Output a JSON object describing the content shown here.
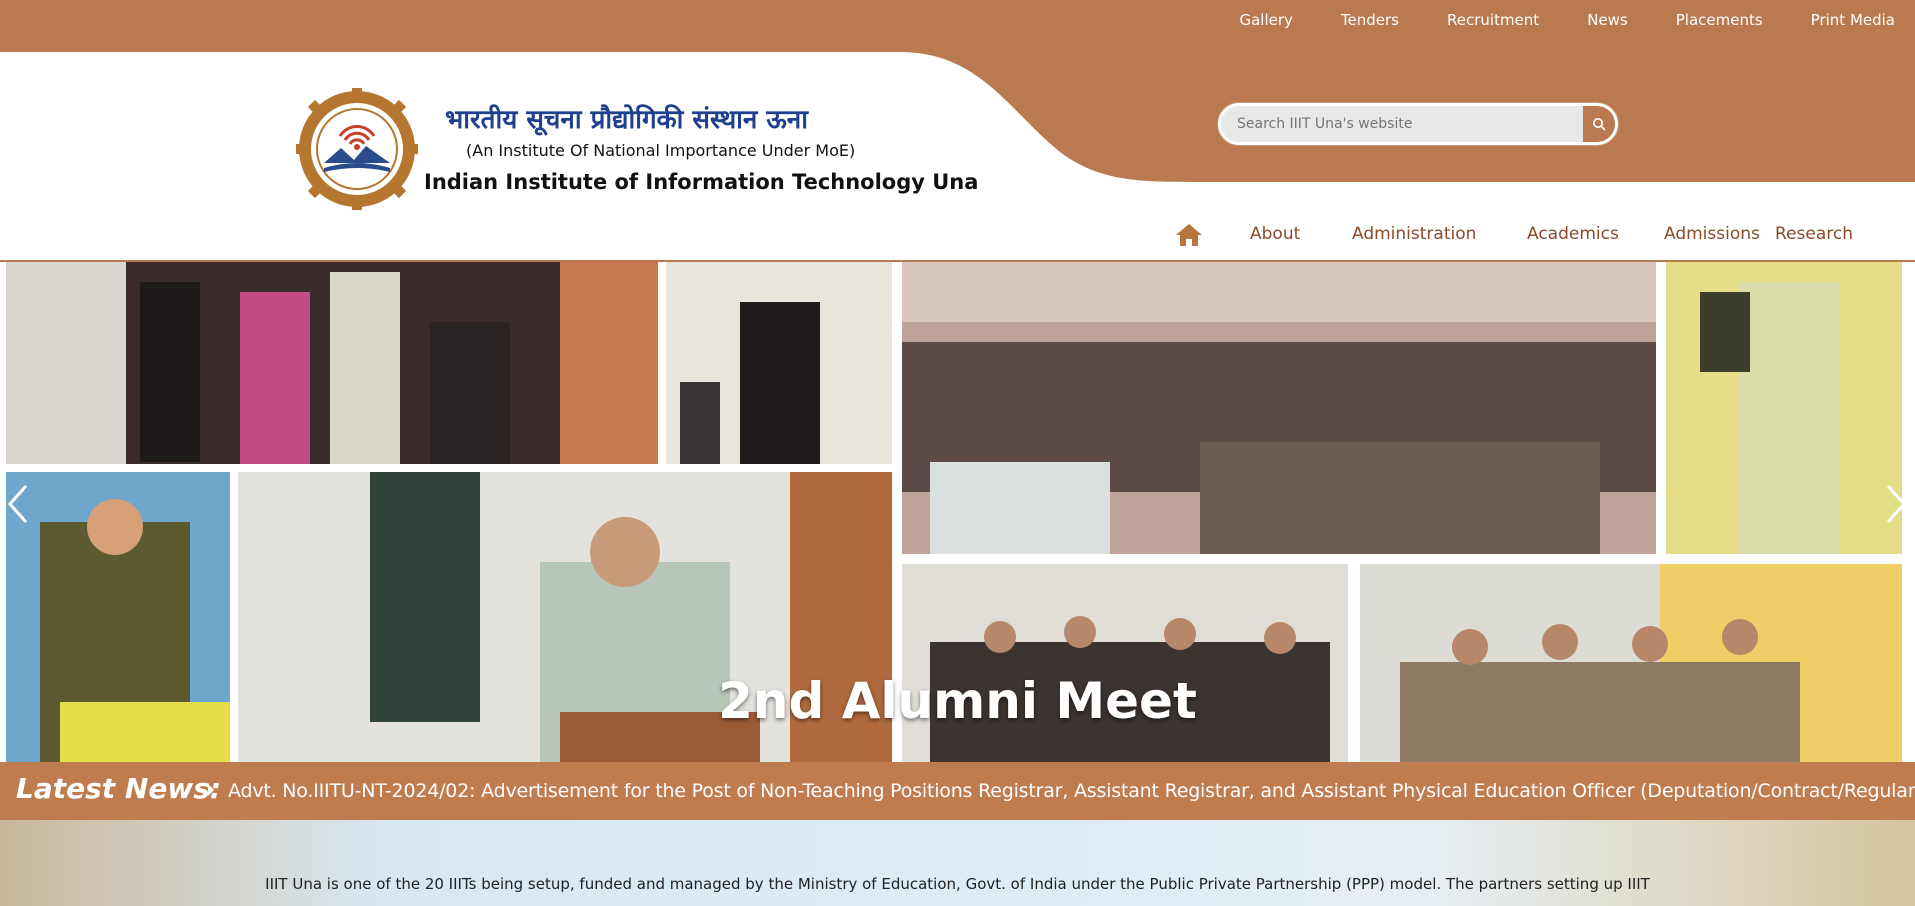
{
  "top_links": [
    "Gallery",
    "Tenders",
    "Recruitment",
    "News",
    "Placements",
    "Print Media"
  ],
  "header": {
    "hindi_name": "भारतीय सूचना प्रौद्योगिकी संस्थान ऊना",
    "subtitle": "(An Institute Of National Importance Under MoE)",
    "title": "Indian Institute of Information Technology Una"
  },
  "search": {
    "placeholder": "Search IIIT Una's website",
    "icon": "search-icon"
  },
  "nav": {
    "home_icon": "home-icon",
    "items": [
      "About",
      "Administration",
      "Academics",
      "Admissions",
      "Research"
    ]
  },
  "slider": {
    "caption": "2nd Alumni Meet",
    "prev_icon": "chevron-left-icon",
    "next_icon": "chevron-right-icon"
  },
  "news": {
    "label": "Latest News:",
    "items": [
      "Advt. No.IIITU-NT-2024/02: Advertisement for the Post of Non-Teaching Positions Registrar, Assistant Registrar, and Assistant Physical Education Officer (Deputation/Contract/Regular Basis)"
    ]
  },
  "intro": "IIIT Una is one of the 20 IIITs being setup, funded and managed by the Ministry of Education, Govt. of India under the Public Private Partnership (PPP) model. The partners setting up IIIT",
  "colors": {
    "brand": "#b97a50",
    "nav_text": "#8b4a2b",
    "hindi_title": "#1f3f8f"
  }
}
